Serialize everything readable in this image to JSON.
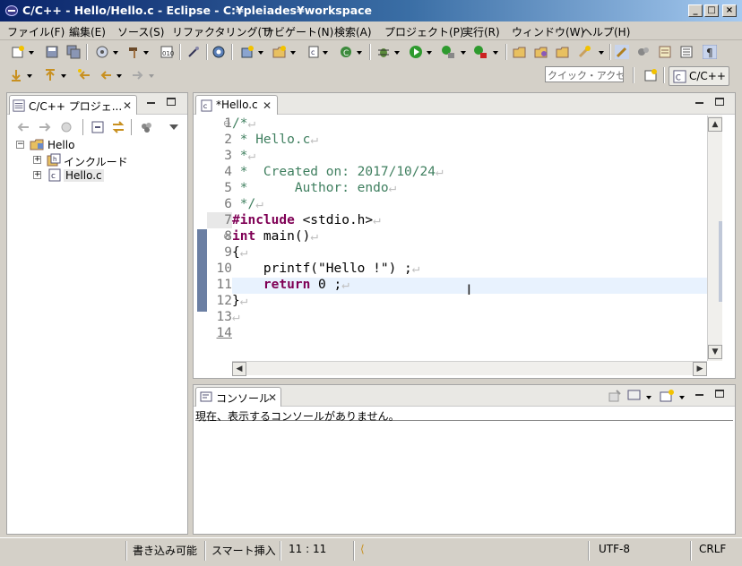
{
  "window": {
    "title": "C/C++ - Hello/Hello.c - Eclipse - C:¥pleiades¥workspace",
    "minimize": "_",
    "maximize": "□",
    "close": "×"
  },
  "menu": [
    "ファイル(F)",
    "編集(E)",
    "ソース(S)",
    "リファクタリング(T)",
    "ナビゲート(N)",
    "検索(A)",
    "プロジェクト(P)",
    "実行(R)",
    "ウィンドウ(W)",
    "ヘルプ(H)"
  ],
  "toolbar": {
    "quick_access_placeholder": "クイック・アクセス",
    "perspective_label": "C/C++"
  },
  "explorer": {
    "tab_label": "C/C++ プロジェ...",
    "tree": [
      {
        "label": "Hello",
        "expander": "−"
      },
      {
        "label": "インクルード",
        "expander": "+"
      },
      {
        "label": "Hello.c",
        "expander": "+"
      }
    ]
  },
  "editor": {
    "tab_label": "*Hello.c",
    "lines": [
      {
        "n": "1",
        "text": "/*"
      },
      {
        "n": "2",
        "text": " * Hello.c"
      },
      {
        "n": "3",
        "text": " *"
      },
      {
        "n": "4",
        "text": " *  Created on: 2017/10/24"
      },
      {
        "n": "5",
        "text": " *      Author: endo"
      },
      {
        "n": "6",
        "text": " */"
      },
      {
        "n": "7",
        "pre": "#include",
        "rest": " <stdio.h>"
      },
      {
        "n": "8",
        "pre": "int",
        "rest": " main()"
      },
      {
        "n": "9",
        "text": "{"
      },
      {
        "n": "10",
        "text": "    printf(\"Hello !\") ;"
      },
      {
        "n": "11",
        "pre": "    return",
        "rest": " 0 ;"
      },
      {
        "n": "12",
        "text": "}"
      },
      {
        "n": "13",
        "text": ""
      },
      {
        "n": "14",
        "text": ""
      }
    ]
  },
  "console": {
    "tab_label": "コンソール",
    "message": "現在、表示するコンソールがありません。"
  },
  "status": {
    "writable": "書き込み可能",
    "insert_mode": "スマート挿入",
    "position": "11 : 11",
    "encoding": "UTF-8",
    "line_delimiter": "CRLF"
  },
  "colors": {
    "title_gradient_start": "#0a246a",
    "keyword": "#7f0055",
    "comment": "#3f7f5f",
    "current_line": "#e8f2fe"
  }
}
